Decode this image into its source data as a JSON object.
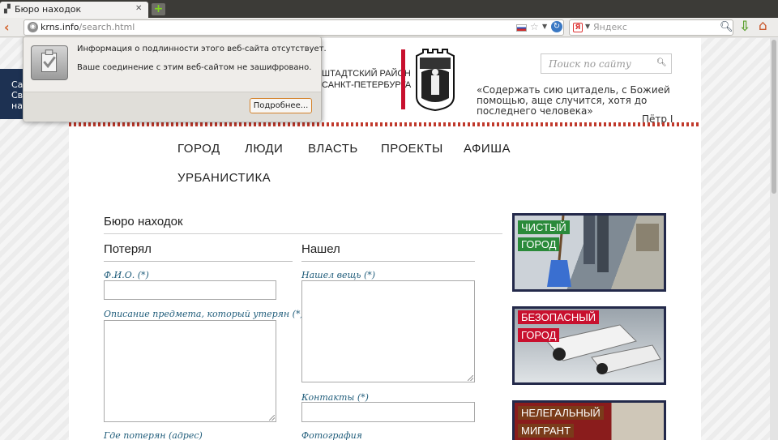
{
  "browser": {
    "tab_title": "Бюро находок",
    "tab_close": "✕",
    "new_tab": "+",
    "url_host": "krns.info",
    "url_path": "/search.html",
    "search_placeholder": "Яндекс",
    "search_engine_label": "Я"
  },
  "identity_popup": {
    "info_text": "Информация о подлинности этого веб-сайта отсутствует.",
    "connection_text": "Ваше соединение с этим веб-сайтом не зашифровано.",
    "more_button": "Подробнее..."
  },
  "side_strip": {
    "lines": [
      "Са",
      "Св",
      "на"
    ]
  },
  "header": {
    "district_line1": "штадтский район",
    "district_line2": "санкт-петербурга",
    "site_search_placeholder": "Поиск по сайту",
    "quote": "«Содержать сию цитадель, с Божией помощью, аще случится, хотя до последнего человека»",
    "quote_author": "Пётр I"
  },
  "nav": {
    "items": [
      "ГОРОД",
      "ЛЮДИ",
      "ВЛАСТЬ",
      "ПРОЕКТЫ",
      "АФИША",
      "УРБАНИСТИКА"
    ]
  },
  "form": {
    "title": "Бюро находок",
    "lost": {
      "heading": "Потерял",
      "name_label": "Ф.И.О. (*)",
      "description_label": "Описание предмета, который утерян (*)",
      "where_label": "Где потерян (адрес)"
    },
    "found": {
      "heading": "Нашел",
      "item_label": "Нашел вещь (*)",
      "contacts_label": "Контакты (*)",
      "photo_label": "Фотография"
    }
  },
  "banners": [
    {
      "line1": "Чистый",
      "line2": "город",
      "color": "#2a8a3a"
    },
    {
      "line1": "Безопасный",
      "line2": "город",
      "color": "#c8102e"
    },
    {
      "line1": "Нелегальный",
      "line2": "мигрант",
      "color": "#7a3b1a"
    }
  ],
  "colors": {
    "accent_red": "#c8102e",
    "label_blue": "#1f5c7a",
    "strip_navy": "#1d3152"
  }
}
